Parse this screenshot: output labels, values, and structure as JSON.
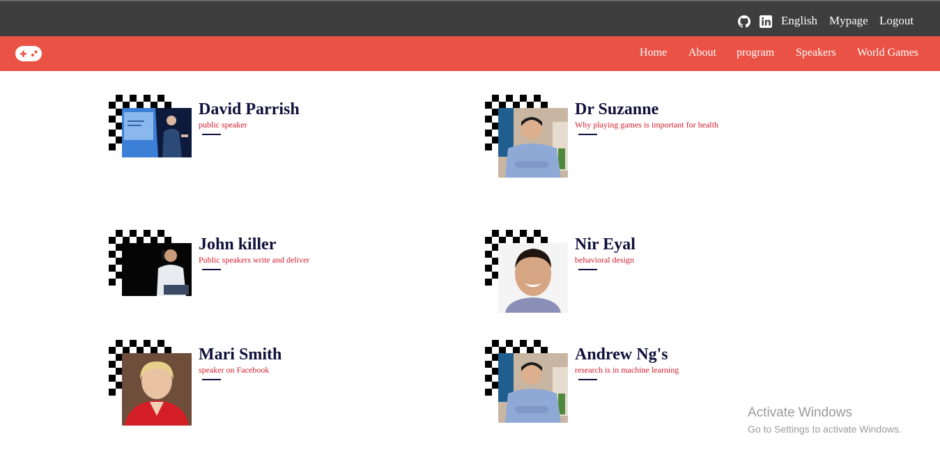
{
  "topbar": {
    "language": "English",
    "mypage": "Mypage",
    "logout": "Logout",
    "icons": [
      "github-icon",
      "linkedin-icon"
    ]
  },
  "nav": {
    "home": "Home",
    "about": "About",
    "program": "program",
    "speakers": "Speakers",
    "world_games": "World Games"
  },
  "speakers": [
    {
      "name": "David Parrish",
      "role": "public speaker"
    },
    {
      "name": "Dr Suzanne",
      "role": "Why playing games is important for health"
    },
    {
      "name": "John killer",
      "role": "Public speakers write and deliver"
    },
    {
      "name": "Nir Eyal",
      "role": "behavioral design"
    },
    {
      "name": "Mari Smith",
      "role": "speaker on Facebook"
    },
    {
      "name": "Andrew Ng's",
      "role": "research is in machine learning"
    }
  ],
  "watermark": {
    "title": "Activate Windows",
    "subtitle": "Go to Settings to activate Windows."
  },
  "colors": {
    "topbar": "#3e3e3e",
    "navbar": "#e95244",
    "name": "#10103a",
    "role": "#d21b2a"
  }
}
